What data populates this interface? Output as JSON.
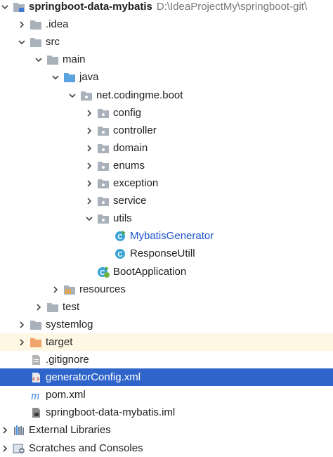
{
  "project": {
    "name": "springboot-data-mybatis",
    "path": "D:\\IdeaProjectMy\\springboot-git\\"
  },
  "items": [
    {
      "name": "idea-folder",
      "label": ".idea",
      "indent": 1,
      "arrow": "right",
      "icon": "folder-icon"
    },
    {
      "name": "src-folder",
      "label": "src",
      "indent": 1,
      "arrow": "down",
      "icon": "folder-icon"
    },
    {
      "name": "main-folder",
      "label": "main",
      "indent": 2,
      "arrow": "down",
      "icon": "folder-icon"
    },
    {
      "name": "java-folder",
      "label": "java",
      "indent": 3,
      "arrow": "down",
      "icon": "source-folder-icon"
    },
    {
      "name": "package-boot",
      "label": "net.codingme.boot",
      "indent": 4,
      "arrow": "down",
      "icon": "package-icon"
    },
    {
      "name": "package-config",
      "label": "config",
      "indent": 5,
      "arrow": "right",
      "icon": "package-icon"
    },
    {
      "name": "package-controller",
      "label": "controller",
      "indent": 5,
      "arrow": "right",
      "icon": "package-icon"
    },
    {
      "name": "package-domain",
      "label": "domain",
      "indent": 5,
      "arrow": "right",
      "icon": "package-icon"
    },
    {
      "name": "package-enums",
      "label": "enums",
      "indent": 5,
      "arrow": "right",
      "icon": "package-icon"
    },
    {
      "name": "package-exception",
      "label": "exception",
      "indent": 5,
      "arrow": "right",
      "icon": "package-icon"
    },
    {
      "name": "package-service",
      "label": "service",
      "indent": 5,
      "arrow": "right",
      "icon": "package-icon"
    },
    {
      "name": "package-utils",
      "label": "utils",
      "indent": 5,
      "arrow": "down",
      "icon": "package-icon"
    },
    {
      "name": "class-mybatis-generator",
      "label": "MybatisGenerator",
      "indent": 6,
      "arrow": "none",
      "icon": "runnable-class-icon",
      "style": "blue"
    },
    {
      "name": "class-response-utill",
      "label": "ResponseUtill",
      "indent": 6,
      "arrow": "none",
      "icon": "class-icon"
    },
    {
      "name": "class-boot-application",
      "label": "BootApplication",
      "indent": 5,
      "arrow": "none",
      "icon": "spring-boot-class-icon"
    },
    {
      "name": "resources-folder",
      "label": "resources",
      "indent": 3,
      "arrow": "right",
      "icon": "resources-folder-icon"
    },
    {
      "name": "test-folder",
      "label": "test",
      "indent": 2,
      "arrow": "right",
      "icon": "folder-icon"
    },
    {
      "name": "systemlog-folder",
      "label": "systemlog",
      "indent": 1,
      "arrow": "right",
      "icon": "folder-icon"
    },
    {
      "name": "target-folder",
      "label": "target",
      "indent": 1,
      "arrow": "right",
      "icon": "excluded-folder-icon",
      "style": "excluded"
    },
    {
      "name": "gitignore-file",
      "label": ".gitignore",
      "indent": 1,
      "arrow": "none",
      "icon": "text-file-icon"
    },
    {
      "name": "generator-config-file",
      "label": "generatorConfig.xml",
      "indent": 1,
      "arrow": "none",
      "icon": "xml-file-icon",
      "style": "selected"
    },
    {
      "name": "pom-file",
      "label": "pom.xml",
      "indent": 1,
      "arrow": "none",
      "icon": "maven-icon"
    },
    {
      "name": "iml-file",
      "label": "springboot-data-mybatis.iml",
      "indent": 1,
      "arrow": "none",
      "icon": "iml-file-icon"
    },
    {
      "name": "external-libraries",
      "label": "External Libraries",
      "indent": 0,
      "arrow": "right",
      "icon": "libraries-icon"
    },
    {
      "name": "scratches-and-consoles",
      "label": "Scratches and Consoles",
      "indent": 0,
      "arrow": "right",
      "icon": "scratches-icon"
    }
  ],
  "colors": {
    "selection": "#2f65ca",
    "excluded": "#fdf7e3",
    "folder": "#a9b1bb",
    "source_folder": "#5ba4df",
    "excluded_folder": "#f0a36a",
    "class_badge": "#3aa3d6"
  }
}
